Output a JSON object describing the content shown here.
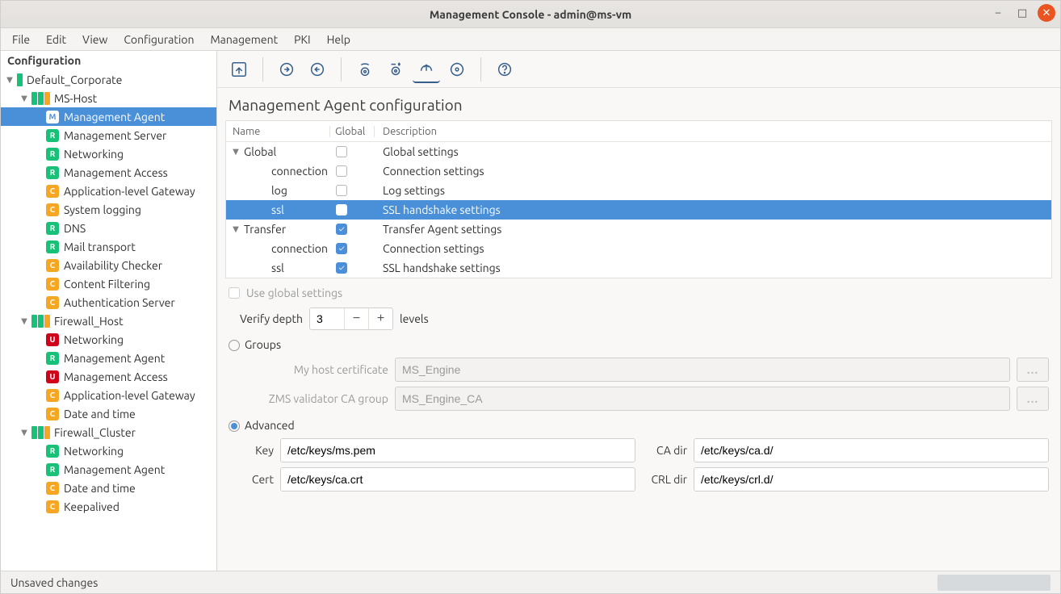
{
  "window": {
    "title": "Management Console - admin@ms-vm"
  },
  "menubar": [
    "File",
    "Edit",
    "View",
    "Configuration",
    "Management",
    "PKI",
    "Help"
  ],
  "sidebar": {
    "header": "Configuration",
    "tree": [
      {
        "depth": 0,
        "kind": "site",
        "expander": "▼",
        "pills": [
          "g"
        ],
        "label": "Default_Corporate"
      },
      {
        "depth": 1,
        "kind": "host",
        "expander": "▼",
        "pills": [
          "g",
          "g",
          "y"
        ],
        "label": "MS-Host"
      },
      {
        "depth": 2,
        "kind": "leaf",
        "badge": "M",
        "label": "Management Agent",
        "selected": true
      },
      {
        "depth": 2,
        "kind": "leaf",
        "badge": "R",
        "label": "Management Server"
      },
      {
        "depth": 2,
        "kind": "leaf",
        "badge": "R",
        "label": "Networking"
      },
      {
        "depth": 2,
        "kind": "leaf",
        "badge": "R",
        "label": "Management Access"
      },
      {
        "depth": 2,
        "kind": "leaf",
        "badge": "C",
        "label": "Application-level Gateway"
      },
      {
        "depth": 2,
        "kind": "leaf",
        "badge": "C",
        "label": "System logging"
      },
      {
        "depth": 2,
        "kind": "leaf",
        "badge": "R",
        "label": "DNS"
      },
      {
        "depth": 2,
        "kind": "leaf",
        "badge": "R",
        "label": "Mail transport"
      },
      {
        "depth": 2,
        "kind": "leaf",
        "badge": "C",
        "label": "Availability Checker"
      },
      {
        "depth": 2,
        "kind": "leaf",
        "badge": "C",
        "label": "Content Filtering"
      },
      {
        "depth": 2,
        "kind": "leaf",
        "badge": "C",
        "label": "Authentication Server"
      },
      {
        "depth": 1,
        "kind": "host",
        "expander": "▼",
        "pills": [
          "g",
          "g",
          "y"
        ],
        "label": "Firewall_Host"
      },
      {
        "depth": 2,
        "kind": "leaf",
        "badge": "U",
        "label": "Networking"
      },
      {
        "depth": 2,
        "kind": "leaf",
        "badge": "R",
        "label": "Management Agent"
      },
      {
        "depth": 2,
        "kind": "leaf",
        "badge": "U",
        "label": "Management Access"
      },
      {
        "depth": 2,
        "kind": "leaf",
        "badge": "C",
        "label": "Application-level Gateway"
      },
      {
        "depth": 2,
        "kind": "leaf",
        "badge": "C",
        "label": "Date and time"
      },
      {
        "depth": 1,
        "kind": "host",
        "expander": "▼",
        "pills": [
          "g",
          "g",
          "y"
        ],
        "label": "Firewall_Cluster"
      },
      {
        "depth": 2,
        "kind": "leaf",
        "badge": "R",
        "label": "Networking"
      },
      {
        "depth": 2,
        "kind": "leaf",
        "badge": "R",
        "label": "Management Agent"
      },
      {
        "depth": 2,
        "kind": "leaf",
        "badge": "C",
        "label": "Date and time"
      },
      {
        "depth": 2,
        "kind": "leaf",
        "badge": "C",
        "label": "Keepalived"
      }
    ]
  },
  "page": {
    "title": "Management Agent configuration"
  },
  "cfg_table": {
    "headers": {
      "name": "Name",
      "global": "Global",
      "desc": "Description"
    },
    "rows": [
      {
        "level": 0,
        "expander": "▼",
        "name": "Global",
        "global": false,
        "desc": "Global settings"
      },
      {
        "level": 1,
        "name": "connection",
        "global": false,
        "desc": "Connection settings"
      },
      {
        "level": 1,
        "name": "log",
        "global": false,
        "desc": "Log settings"
      },
      {
        "level": 1,
        "name": "ssl",
        "global": false,
        "desc": "SSL handshake settings",
        "selected": true
      },
      {
        "level": 0,
        "expander": "▼",
        "name": "Transfer",
        "global": true,
        "desc": "Transfer Agent settings"
      },
      {
        "level": 1,
        "name": "connection",
        "global": true,
        "desc": "Connection settings"
      },
      {
        "level": 1,
        "name": "ssl",
        "global": true,
        "desc": "SSL handshake settings"
      }
    ]
  },
  "details": {
    "use_global_label": "Use global settings",
    "verify_depth_label": "Verify depth",
    "verify_depth_value": "3",
    "levels_label": "levels",
    "groups_label": "Groups",
    "advanced_label": "Advanced",
    "my_host_cert_label": "My host certificate",
    "my_host_cert_value": "MS_Engine",
    "zms_ca_label": "ZMS validator CA group",
    "zms_ca_value": "MS_Engine_CA",
    "key_label": "Key",
    "key_value": "/etc/keys/ms.pem",
    "cert_label": "Cert",
    "cert_value": "/etc/keys/ca.crt",
    "ca_dir_label": "CA dir",
    "ca_dir_value": "/etc/keys/ca.d/",
    "crl_dir_label": "CRL dir",
    "crl_dir_value": "/etc/keys/crl.d/"
  },
  "status": {
    "left": "Unsaved changes"
  }
}
